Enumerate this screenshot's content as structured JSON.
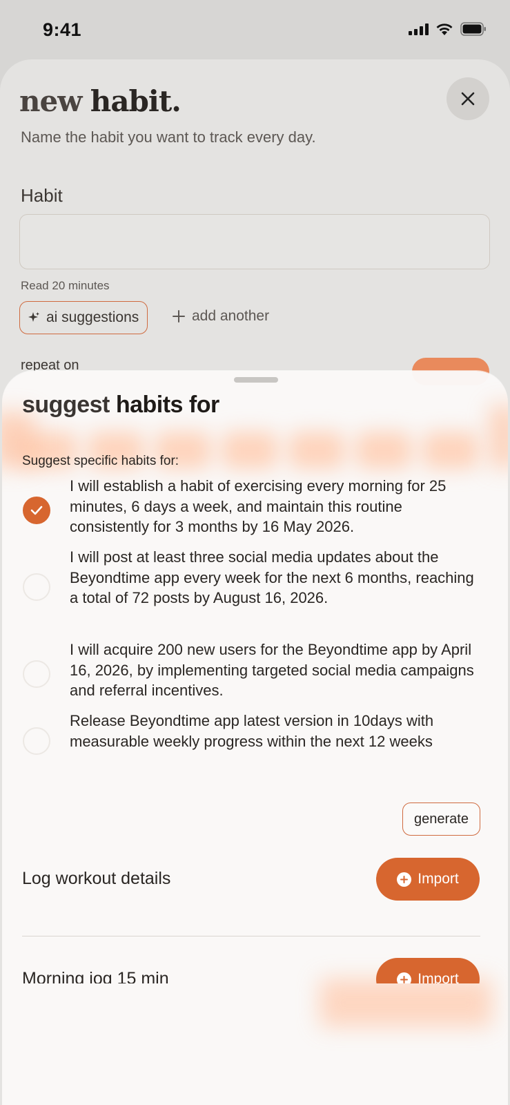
{
  "status_bar": {
    "time": "9:41"
  },
  "background_sheet": {
    "title_light": "new",
    "title_bold": "habit.",
    "subtitle": "Name the habit you want to track every day.",
    "habit_label": "Habit",
    "habit_input": {
      "value": "",
      "placeholder": ""
    },
    "habit_hint": "Read 20 minutes",
    "ai_suggestions_label": "ai suggestions",
    "add_another_label": "add another",
    "repeat_label": "repeat on"
  },
  "suggest_sheet": {
    "title_light": "suggest",
    "title_bold": "habits for",
    "prompt_label": "Suggest specific habits for:",
    "options": [
      {
        "text": "I will establish a habit of exercising every morning for 25 minutes, 6 days a week, and maintain this routine consistently for 3 months by 16 May 2026.",
        "selected": true
      },
      {
        "text": "I will post at least three social media updates about the Beyondtime app every week for the next 6 months, reaching a total of 72 posts by August 16, 2026.",
        "selected": false
      },
      {
        "text": "I will acquire 200 new users for the Beyondtime app by April 16, 2026, by implementing targeted social media campaigns and referral incentives.",
        "selected": false
      },
      {
        "text": "Release Beyondtime app latest version in 10days with measurable weekly progress within the next 12 weeks",
        "selected": false
      }
    ],
    "generate_label": "generate",
    "import_items": [
      {
        "title": "Log workout details",
        "button_label": "Import"
      },
      {
        "title": "Morning jog 15 min",
        "button_label": "Import"
      }
    ]
  },
  "colors": {
    "accent": "#d7662f",
    "accent_outline": "#cf6a3f",
    "sheet_background": "#faf9f8",
    "backdrop": "#d7d6d4"
  },
  "icons": {
    "close": "close-icon",
    "sparkle": "sparkle-icon",
    "plus": "plus-icon",
    "check": "check-icon",
    "import_plus": "plus-circle-icon"
  }
}
